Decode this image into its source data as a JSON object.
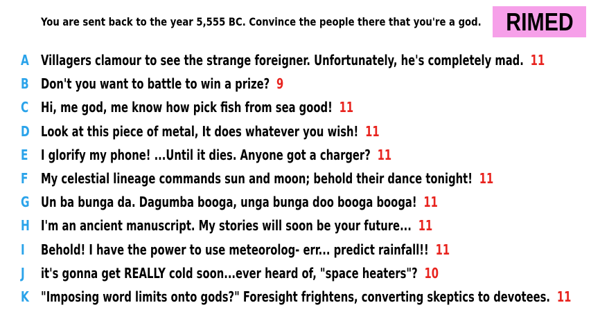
{
  "prompt": "You are sent back to the year 5,555 BC. Convince the people there that you're a god.",
  "badge": "RIMED",
  "colors": {
    "letter": "#2aa3ea",
    "score": "#e8231e",
    "badge_bg": "#f6a0e9"
  },
  "answers": [
    {
      "letter": "A",
      "text": "Villagers clamour to see the strange foreigner. Unfortunately, he's completely mad.",
      "score": "11"
    },
    {
      "letter": "B",
      "text": "Don't you want to battle to win a prize?",
      "score": "9"
    },
    {
      "letter": "C",
      "text": "Hi, me god, me know how pick fish from sea good!",
      "score": "11"
    },
    {
      "letter": "D",
      "text": "Look at this piece of metal, It does whatever you wish!",
      "score": "11"
    },
    {
      "letter": "E",
      "text": "I glorify my phone! ...Until it dies. Anyone got a charger?",
      "score": "11"
    },
    {
      "letter": "F",
      "text": "My celestial lineage commands sun and moon; behold their dance tonight!",
      "score": "11"
    },
    {
      "letter": "G",
      "text": "Un ba bunga da. Dagumba booga, unga bunga doo booga booga!",
      "score": "11"
    },
    {
      "letter": "H",
      "text": "I'm an ancient manuscript. My stories will soon be your future...",
      "score": "11"
    },
    {
      "letter": "I",
      "text": "Behold! I have the power to use meteorolog- err... predict rainfall!!",
      "score": "11"
    },
    {
      "letter": "J",
      "text": "it's gonna get REALLY cold soon...ever heard of, \"space heaters\"?",
      "score": "10"
    },
    {
      "letter": "K",
      "text": "\"Imposing word limits onto gods?\" Foresight frightens, converting skeptics to devotees.",
      "score": "11"
    }
  ]
}
